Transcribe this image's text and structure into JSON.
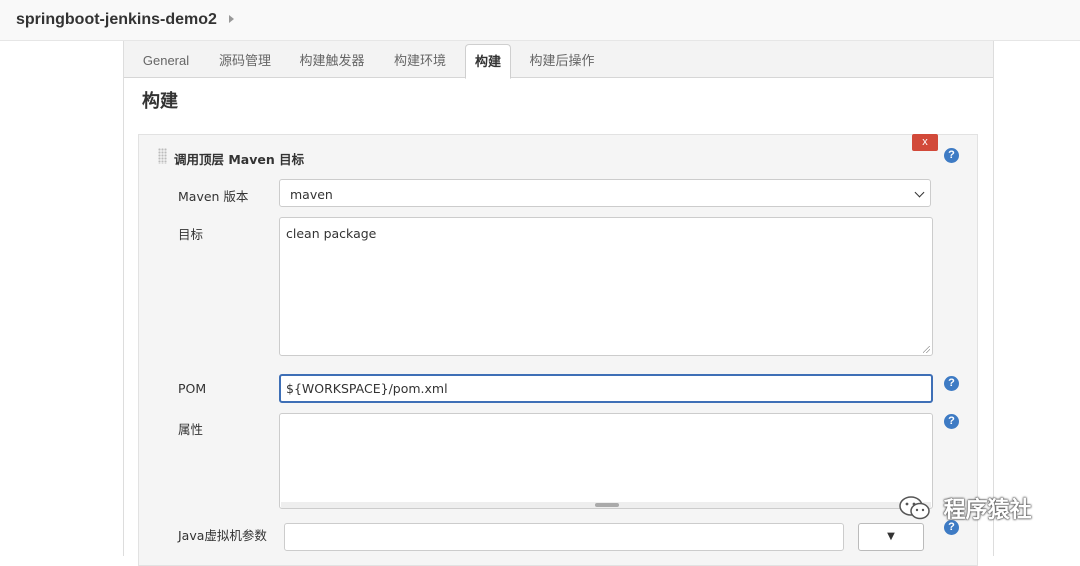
{
  "breadcrumb": {
    "title": "springboot-jenkins-demo2"
  },
  "tabs": [
    {
      "label": "General"
    },
    {
      "label": "源码管理"
    },
    {
      "label": "构建触发器"
    },
    {
      "label": "构建环境"
    },
    {
      "label": "构建"
    },
    {
      "label": "构建后操作"
    }
  ],
  "active_tab": "构建",
  "section": {
    "title": "构建"
  },
  "step": {
    "title": "调用顶层 Maven 目标",
    "delete_label": "x",
    "help_glyph": "?"
  },
  "fields": {
    "maven_version": {
      "label": "Maven 版本",
      "value": "maven"
    },
    "goals": {
      "label": "目标",
      "value": "clean package"
    },
    "pom": {
      "label": "POM",
      "value": "${WORKSPACE}/pom.xml"
    },
    "properties": {
      "label": "属性",
      "value": ""
    },
    "jvm_options": {
      "label": "Java虚拟机参数",
      "value": "",
      "dropdown_glyph": "▼"
    }
  },
  "watermark": {
    "text": "程序猿社"
  },
  "colors": {
    "accent": "#3e6fb6",
    "help": "#3e7bc4",
    "delete": "#d24939"
  }
}
